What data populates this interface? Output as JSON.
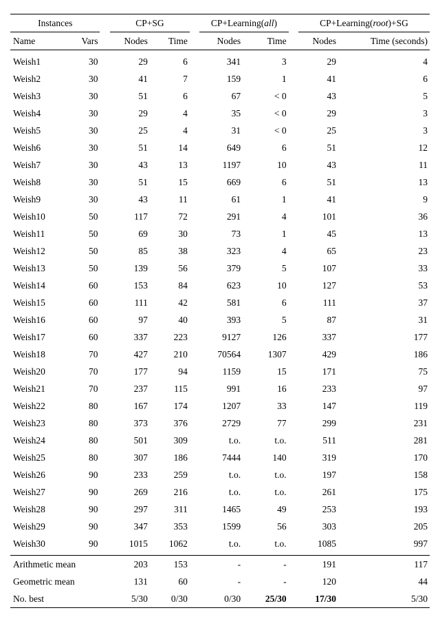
{
  "headers": {
    "group_instances": "Instances",
    "group_cpsg": "CP+SG",
    "group_cplearn_all_pre": "CP+Learning(",
    "group_cplearn_all_mid": "all",
    "group_cplearn_all_post": ")",
    "group_cplearn_root_pre": "CP+Learning(",
    "group_cplearn_root_mid": "root",
    "group_cplearn_root_post": ")+SG",
    "sub_name": "Name",
    "sub_vars": "Vars",
    "sub_nodes": "Nodes",
    "sub_time": "Time",
    "sub_time_seconds": "Time (seconds)"
  },
  "chart_data": {
    "type": "table",
    "columns": [
      "Name",
      "Vars",
      "Nodes1",
      "Time1",
      "Nodes2",
      "Time2",
      "Nodes3",
      "Time3"
    ],
    "rows": [
      {
        "Name": "Weish1",
        "Vars": "30",
        "Nodes1": "29",
        "Time1": "6",
        "Nodes2": "341",
        "Time2": "3",
        "Nodes3": "29",
        "Time3": "4"
      },
      {
        "Name": "Weish2",
        "Vars": "30",
        "Nodes1": "41",
        "Time1": "7",
        "Nodes2": "159",
        "Time2": "1",
        "Nodes3": "41",
        "Time3": "6"
      },
      {
        "Name": "Weish3",
        "Vars": "30",
        "Nodes1": "51",
        "Time1": "6",
        "Nodes2": "67",
        "Time2": "< 0",
        "Nodes3": "43",
        "Time3": "5"
      },
      {
        "Name": "Weish4",
        "Vars": "30",
        "Nodes1": "29",
        "Time1": "4",
        "Nodes2": "35",
        "Time2": "< 0",
        "Nodes3": "29",
        "Time3": "3"
      },
      {
        "Name": "Weish5",
        "Vars": "30",
        "Nodes1": "25",
        "Time1": "4",
        "Nodes2": "31",
        "Time2": "< 0",
        "Nodes3": "25",
        "Time3": "3"
      },
      {
        "Name": "Weish6",
        "Vars": "30",
        "Nodes1": "51",
        "Time1": "14",
        "Nodes2": "649",
        "Time2": "6",
        "Nodes3": "51",
        "Time3": "12"
      },
      {
        "Name": "Weish7",
        "Vars": "30",
        "Nodes1": "43",
        "Time1": "13",
        "Nodes2": "1197",
        "Time2": "10",
        "Nodes3": "43",
        "Time3": "11"
      },
      {
        "Name": "Weish8",
        "Vars": "30",
        "Nodes1": "51",
        "Time1": "15",
        "Nodes2": "669",
        "Time2": "6",
        "Nodes3": "51",
        "Time3": "13"
      },
      {
        "Name": "Weish9",
        "Vars": "30",
        "Nodes1": "43",
        "Time1": "11",
        "Nodes2": "61",
        "Time2": "1",
        "Nodes3": "41",
        "Time3": "9"
      },
      {
        "Name": "Weish10",
        "Vars": "50",
        "Nodes1": "117",
        "Time1": "72",
        "Nodes2": "291",
        "Time2": "4",
        "Nodes3": "101",
        "Time3": "36"
      },
      {
        "Name": "Weish11",
        "Vars": "50",
        "Nodes1": "69",
        "Time1": "30",
        "Nodes2": "73",
        "Time2": "1",
        "Nodes3": "45",
        "Time3": "13"
      },
      {
        "Name": "Weish12",
        "Vars": "50",
        "Nodes1": "85",
        "Time1": "38",
        "Nodes2": "323",
        "Time2": "4",
        "Nodes3": "65",
        "Time3": "23"
      },
      {
        "Name": "Weish13",
        "Vars": "50",
        "Nodes1": "139",
        "Time1": "56",
        "Nodes2": "379",
        "Time2": "5",
        "Nodes3": "107",
        "Time3": "33"
      },
      {
        "Name": "Weish14",
        "Vars": "60",
        "Nodes1": "153",
        "Time1": "84",
        "Nodes2": "623",
        "Time2": "10",
        "Nodes3": "127",
        "Time3": "53"
      },
      {
        "Name": "Weish15",
        "Vars": "60",
        "Nodes1": "111",
        "Time1": "42",
        "Nodes2": "581",
        "Time2": "6",
        "Nodes3": "111",
        "Time3": "37"
      },
      {
        "Name": "Weish16",
        "Vars": "60",
        "Nodes1": "97",
        "Time1": "40",
        "Nodes2": "393",
        "Time2": "5",
        "Nodes3": "87",
        "Time3": "31"
      },
      {
        "Name": "Weish17",
        "Vars": "60",
        "Nodes1": "337",
        "Time1": "223",
        "Nodes2": "9127",
        "Time2": "126",
        "Nodes3": "337",
        "Time3": "177"
      },
      {
        "Name": "Weish18",
        "Vars": "70",
        "Nodes1": "427",
        "Time1": "210",
        "Nodes2": "70564",
        "Time2": "1307",
        "Nodes3": "429",
        "Time3": "186"
      },
      {
        "Name": "Weish20",
        "Vars": "70",
        "Nodes1": "177",
        "Time1": "94",
        "Nodes2": "1159",
        "Time2": "15",
        "Nodes3": "171",
        "Time3": "75"
      },
      {
        "Name": "Weish21",
        "Vars": "70",
        "Nodes1": "237",
        "Time1": "115",
        "Nodes2": "991",
        "Time2": "16",
        "Nodes3": "233",
        "Time3": "97"
      },
      {
        "Name": "Weish22",
        "Vars": "80",
        "Nodes1": "167",
        "Time1": "174",
        "Nodes2": "1207",
        "Time2": "33",
        "Nodes3": "147",
        "Time3": "119"
      },
      {
        "Name": "Weish23",
        "Vars": "80",
        "Nodes1": "373",
        "Time1": "376",
        "Nodes2": "2729",
        "Time2": "77",
        "Nodes3": "299",
        "Time3": "231"
      },
      {
        "Name": "Weish24",
        "Vars": "80",
        "Nodes1": "501",
        "Time1": "309",
        "Nodes2": "t.o.",
        "Time2": "t.o.",
        "Nodes3": "511",
        "Time3": "281"
      },
      {
        "Name": "Weish25",
        "Vars": "80",
        "Nodes1": "307",
        "Time1": "186",
        "Nodes2": "7444",
        "Time2": "140",
        "Nodes3": "319",
        "Time3": "170"
      },
      {
        "Name": "Weish26",
        "Vars": "90",
        "Nodes1": "233",
        "Time1": "259",
        "Nodes2": "t.o.",
        "Time2": "t.o.",
        "Nodes3": "197",
        "Time3": "158"
      },
      {
        "Name": "Weish27",
        "Vars": "90",
        "Nodes1": "269",
        "Time1": "216",
        "Nodes2": "t.o.",
        "Time2": "t.o.",
        "Nodes3": "261",
        "Time3": "175"
      },
      {
        "Name": "Weish28",
        "Vars": "90",
        "Nodes1": "297",
        "Time1": "311",
        "Nodes2": "1465",
        "Time2": "49",
        "Nodes3": "253",
        "Time3": "193"
      },
      {
        "Name": "Weish29",
        "Vars": "90",
        "Nodes1": "347",
        "Time1": "353",
        "Nodes2": "1599",
        "Time2": "56",
        "Nodes3": "303",
        "Time3": "205"
      },
      {
        "Name": "Weish30",
        "Vars": "90",
        "Nodes1": "1015",
        "Time1": "1062",
        "Nodes2": "t.o.",
        "Time2": "t.o.",
        "Nodes3": "1085",
        "Time3": "997"
      }
    ],
    "summary": [
      {
        "label": "Arithmetic mean",
        "Nodes1": "203",
        "Time1": "153",
        "Nodes2": "-",
        "Time2": "-",
        "Nodes3": "191",
        "Time3": "117"
      },
      {
        "label": "Geometric mean",
        "Nodes1": "131",
        "Time1": "60",
        "Nodes2": "-",
        "Time2": "-",
        "Nodes3": "120",
        "Time3": "44"
      },
      {
        "label": "No. best",
        "Nodes1": "5/30",
        "Time1": "0/30",
        "Nodes2": "0/30",
        "Time2": "25/30",
        "Nodes3": "17/30",
        "Time3": "5/30",
        "bold": {
          "Time2": true,
          "Nodes3": true
        }
      }
    ]
  }
}
